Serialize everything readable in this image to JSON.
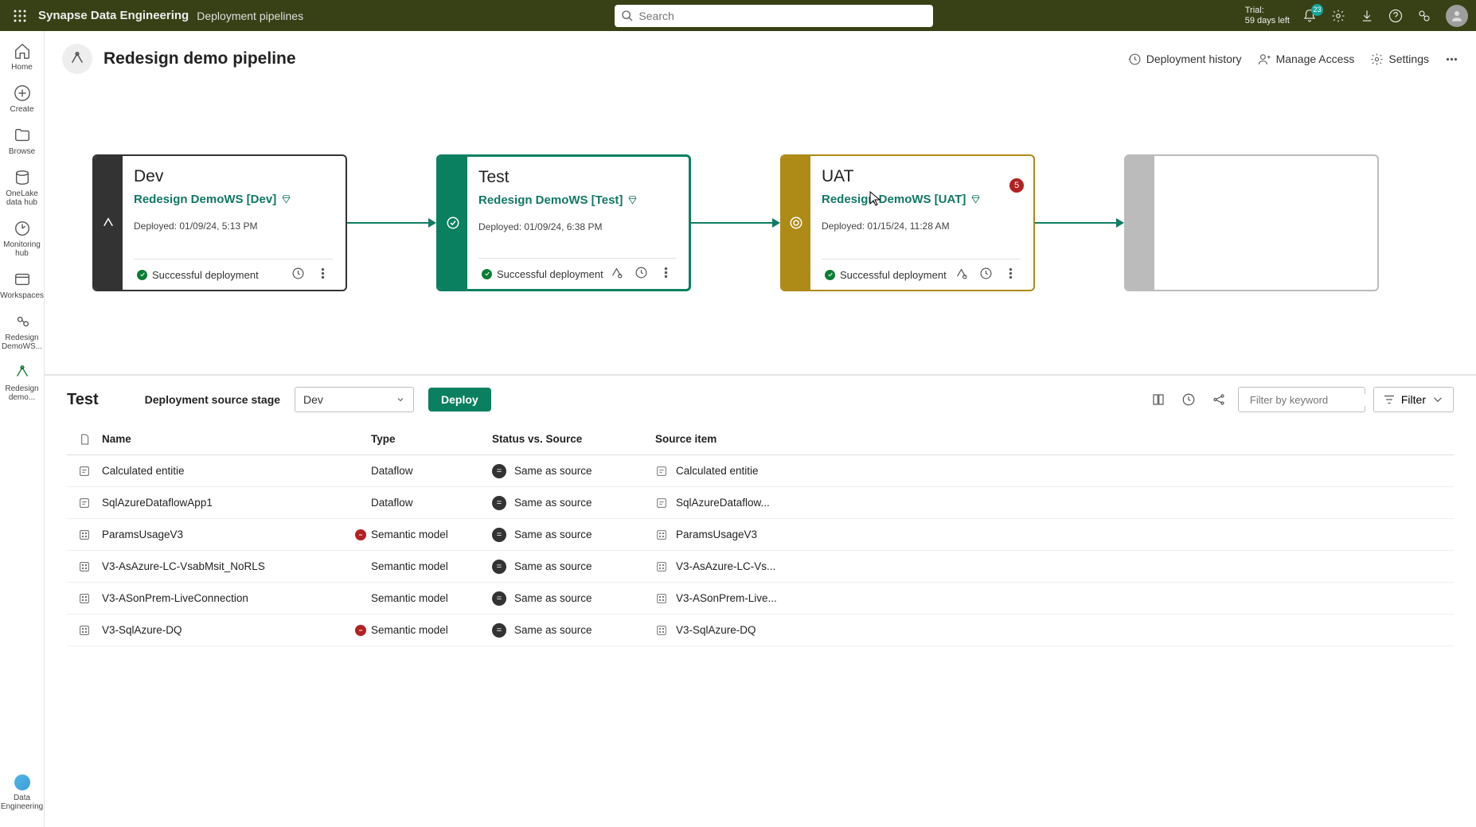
{
  "header": {
    "brand": "Synapse Data Engineering",
    "sub": "Deployment pipelines",
    "search_placeholder": "Search",
    "trial_line1": "Trial:",
    "trial_line2": "59 days left",
    "notif_count": "23"
  },
  "rail": {
    "home": "Home",
    "create": "Create",
    "browse": "Browse",
    "onelake": "OneLake data hub",
    "monitor": "Monitoring hub",
    "workspaces": "Workspaces",
    "ws1": "Redesign DemoWS...",
    "ws2": "Redesign demo...",
    "bottom": "Data Engineering"
  },
  "page": {
    "title": "Redesign demo pipeline",
    "history": "Deployment history",
    "access": "Manage Access",
    "settings": "Settings"
  },
  "stages": {
    "dev": {
      "name": "Dev",
      "ws": "Redesign DemoWS [Dev]",
      "deployed": "Deployed: 01/09/24, 5:13 PM",
      "status": "Successful deployment"
    },
    "test": {
      "name": "Test",
      "ws": "Redesign DemoWS [Test]",
      "deployed": "Deployed: 01/09/24, 6:38 PM",
      "status": "Successful deployment"
    },
    "uat": {
      "name": "UAT",
      "ws": "Redesign DemoWS [UAT]",
      "deployed": "Deployed: 01/15/24, 11:28 AM",
      "status": "Successful deployment",
      "count": "5"
    }
  },
  "detail": {
    "title": "Test",
    "srclabel": "Deployment source stage",
    "srcvalue": "Dev",
    "deploy": "Deploy",
    "filter_placeholder": "Filter by keyword",
    "filter_btn": "Filter",
    "cols": {
      "name": "Name",
      "type": "Type",
      "status": "Status vs. Source",
      "source": "Source item"
    },
    "rows": [
      {
        "icon": "df",
        "name": "Calculated entitie",
        "err": false,
        "type": "Dataflow",
        "stat": "Same as source",
        "src": "Calculated entitie"
      },
      {
        "icon": "df",
        "name": "SqlAzureDataflowApp1",
        "err": false,
        "type": "Dataflow",
        "stat": "Same as source",
        "src": "SqlAzureDataflow..."
      },
      {
        "icon": "sm",
        "name": "ParamsUsageV3",
        "err": true,
        "type": "Semantic model",
        "stat": "Same as source",
        "src": "ParamsUsageV3"
      },
      {
        "icon": "sm",
        "name": "V3-AsAzure-LC-VsabMsit_NoRLS",
        "err": false,
        "type": "Semantic model",
        "stat": "Same as source",
        "src": "V3-AsAzure-LC-Vs..."
      },
      {
        "icon": "sm",
        "name": "V3-ASonPrem-LiveConnection",
        "err": false,
        "type": "Semantic model",
        "stat": "Same as source",
        "src": "V3-ASonPrem-Live..."
      },
      {
        "icon": "sm",
        "name": "V3-SqlAzure-DQ",
        "err": true,
        "type": "Semantic model",
        "stat": "Same as source",
        "src": "V3-SqlAzure-DQ"
      }
    ]
  }
}
